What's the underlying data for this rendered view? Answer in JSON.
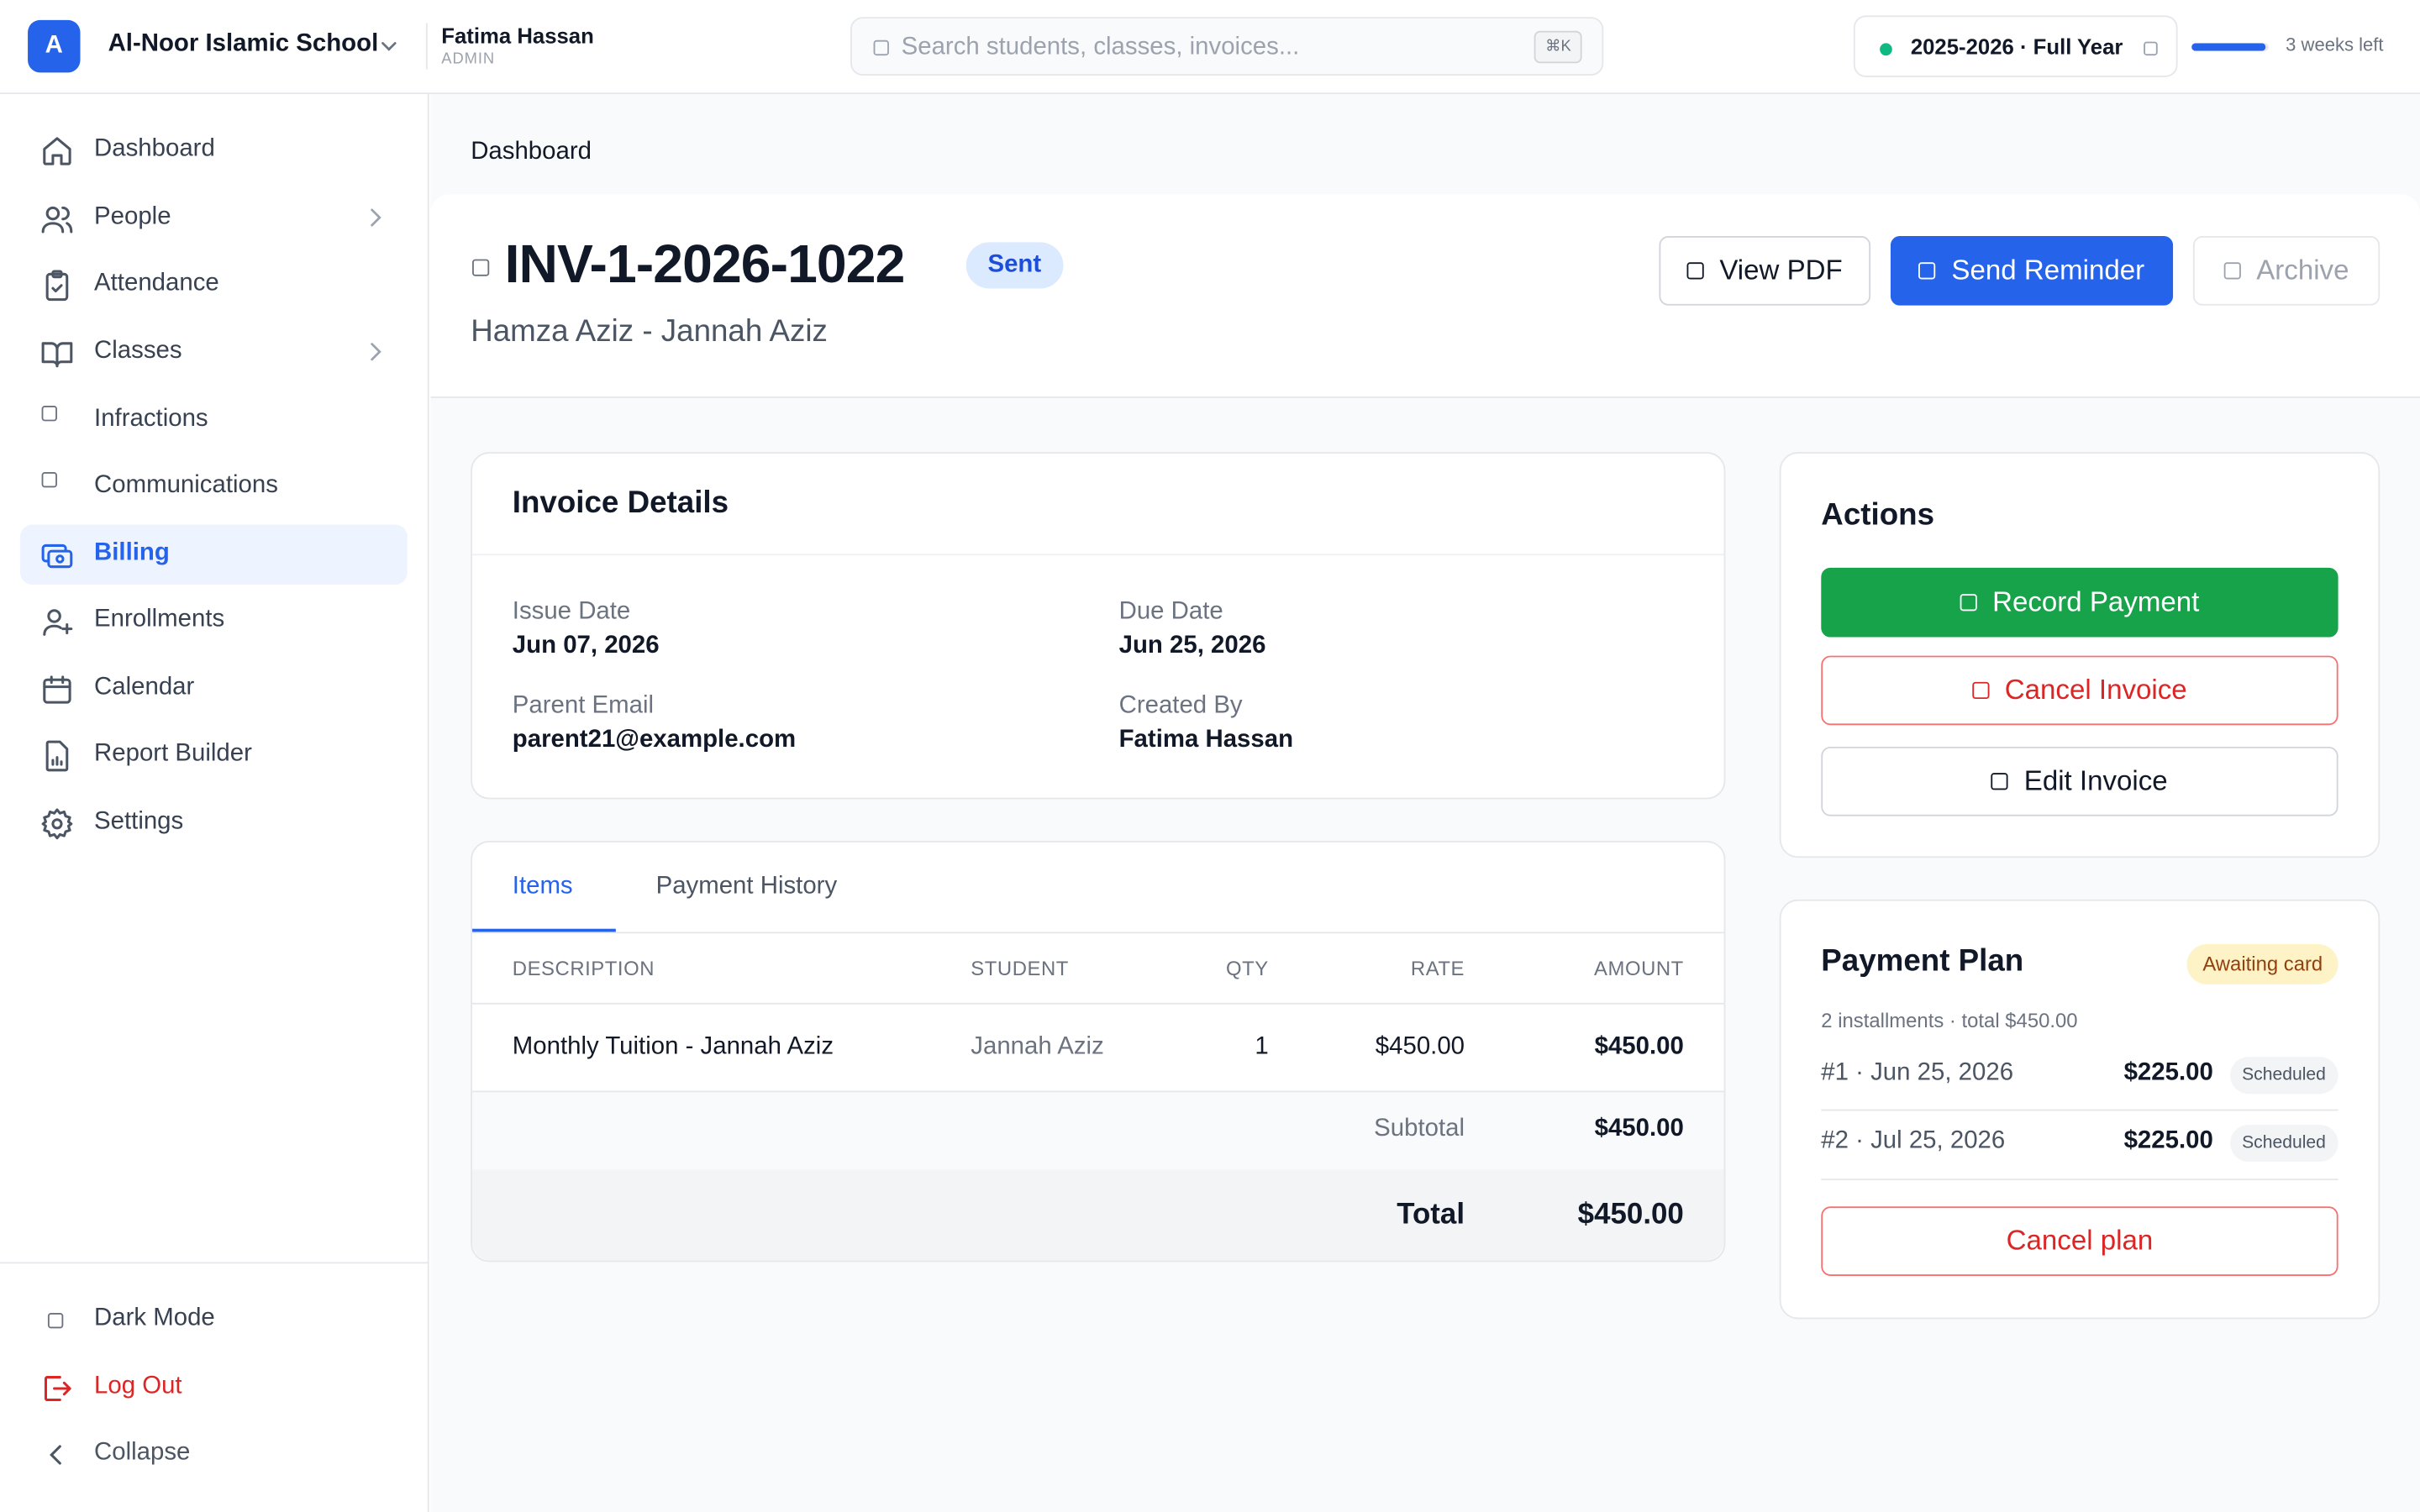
{
  "topbar": {
    "org_initial": "A",
    "org_name": "Al-Noor Islamic School",
    "user_name": "Fatima Hassan",
    "user_role": "ADMIN",
    "search_placeholder": "Search students, classes, invoices...",
    "search_shortcut": "⌘K",
    "school_year": "2025-2026 · Full Year",
    "year_status_color": "#10b981",
    "year_progress": 0.95,
    "weeks_left": "3 weeks left"
  },
  "sidebar": {
    "items": [
      {
        "label": "Dashboard",
        "icon": "home-icon"
      },
      {
        "label": "People",
        "icon": "users-icon",
        "has_children": true
      },
      {
        "label": "Attendance",
        "icon": "clipboard-check-icon"
      },
      {
        "label": "Classes",
        "icon": "book-open-icon",
        "has_children": true
      },
      {
        "label": "Infractions",
        "icon": "square-icon"
      },
      {
        "label": "Communications",
        "icon": "square-icon"
      },
      {
        "label": "Billing",
        "icon": "banknote-icon",
        "active": true
      },
      {
        "label": "Enrollments",
        "icon": "user-plus-icon"
      },
      {
        "label": "Calendar",
        "icon": "calendar-icon"
      },
      {
        "label": "Report Builder",
        "icon": "file-chart-icon"
      },
      {
        "label": "Settings",
        "icon": "gear-icon"
      }
    ],
    "footer": {
      "dark_mode": "Dark Mode",
      "logout": "Log Out",
      "collapse": "Collapse"
    }
  },
  "main": {
    "breadcrumb": "Dashboard",
    "invoice": {
      "number": "INV-1-2026-1022",
      "status": "Sent",
      "subtitle": "Hamza Aziz - Jannah Aziz"
    },
    "header_buttons": {
      "view_pdf": "View PDF",
      "send_reminder": "Send Reminder",
      "archive": "Archive"
    },
    "details": {
      "title": "Invoice Details",
      "issue_date_label": "Issue Date",
      "issue_date": "Jun 07, 2026",
      "due_date_label": "Due Date",
      "due_date": "Jun 25, 2026",
      "parent_email_label": "Parent Email",
      "parent_email": "parent21@example.com",
      "created_by_label": "Created By",
      "created_by": "Fatima Hassan"
    },
    "tabs": [
      {
        "label": "Items",
        "active": true
      },
      {
        "label": "Payment History"
      }
    ],
    "items_table": {
      "columns": [
        "DESCRIPTION",
        "STUDENT",
        "QTY",
        "RATE",
        "AMOUNT"
      ],
      "rows": [
        {
          "description": "Monthly Tuition - Jannah Aziz",
          "student": "Jannah Aziz",
          "qty": "1",
          "rate": "$450.00",
          "amount": "$450.00"
        }
      ],
      "subtotal_label": "Subtotal",
      "subtotal": "$450.00",
      "total_label": "Total",
      "total": "$450.00"
    },
    "actions": {
      "title": "Actions",
      "record_payment": "Record Payment",
      "cancel_invoice": "Cancel Invoice",
      "edit_invoice": "Edit Invoice"
    },
    "payment_plan": {
      "title": "Payment Plan",
      "status": "Awaiting card",
      "summary": "2 installments · total $450.00",
      "installments": [
        {
          "label": "#1 · Jun 25, 2026",
          "amount": "$225.00",
          "status": "Scheduled"
        },
        {
          "label": "#2 · Jul 25, 2026",
          "amount": "$225.00",
          "status": "Scheduled"
        }
      ],
      "cancel_plan": "Cancel plan"
    }
  },
  "colors": {
    "primary": "#2563eb",
    "success": "#16a34a",
    "danger": "#dc2626",
    "warning_bg": "#fef3c7"
  }
}
